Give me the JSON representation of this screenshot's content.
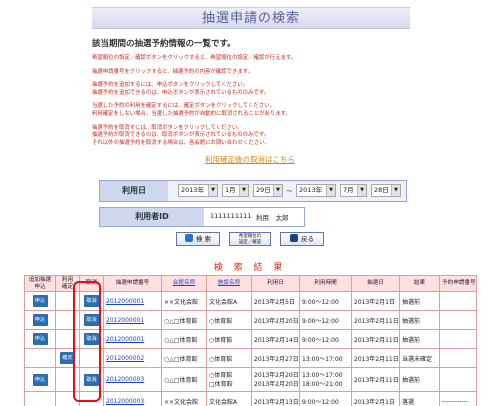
{
  "page": {
    "title": "抽選申請の検索"
  },
  "intro": {
    "heading": "該当期間の抽選予約情報の一覧です。",
    "lines": [
      "希望順位の設定／確認ボタンをクリックすると、希望順位の設定／確認が行えます。",
      "",
      "抽選申請番号をクリックすると、抽選予約の内容が確認できます。",
      "",
      "抽選予約を追加するには、申込ボタンをクリックしてください。",
      "抽選予約を追加できるのは、申込ボタンが表示されているもののみです。",
      "",
      "当選した予約の利用を確定するには、確定ボタンをクリックしてください。",
      "利用確定をしない場合、当選した抽選予約が自動的に取消されることがあります。",
      "",
      "抽選予約を取消すには、取消ボタンをクリックしてください。",
      "抽選予約が取消できるのは、取消ボタンが表示されているもののみです。",
      "それ以外の抽選予約を取消する場合は、各会館にお問い合わせください。"
    ]
  },
  "after_cancel_link": "利用確定後の取消はこちら",
  "search": {
    "date_label": "利用日",
    "from": {
      "year": "2013年",
      "month": "1月",
      "day": "29日"
    },
    "separator": "～",
    "to": {
      "year": "2013年",
      "month": "7月",
      "day": "28日"
    },
    "user_label": "利用者ID",
    "user_id": "1111111111",
    "user_name": "利用　太郎"
  },
  "buttons": {
    "search": "検 索",
    "priority_line1": "希望順位の",
    "priority_line2": "設定／確認",
    "back": "戻る"
  },
  "results": {
    "title": "検 索 結 果",
    "headers": {
      "apply_line1": "追加抽選",
      "apply_line2": "申込",
      "confirm_line1": "利用",
      "confirm_line2": "確定",
      "cancel": "取消",
      "number": "抽選申請番号",
      "hall": "会館名称",
      "facility": "施設名称",
      "use_date": "利用日",
      "use_time": "利用時間",
      "lottery_date": "抽選日",
      "result": "結果",
      "reservation_no": "予約申請番号"
    },
    "action_labels": {
      "apply": "申込",
      "confirm": "確定",
      "cancel": "取消"
    },
    "rows": [
      {
        "number": "2012000001",
        "hall": "××文化会館",
        "facility": "文化会館A",
        "date": "2013年2月5日",
        "time": "9:00～12:00",
        "lottery": "2013年2月1日",
        "result": "抽選前",
        "reservation": ""
      },
      {
        "number": "2012000001",
        "hall": "○△□体育館",
        "facility": "○体育館",
        "date": "2013年2月20日",
        "time": "9:00～12:00",
        "lottery": "2013年2月11日",
        "result": "抽選前",
        "reservation": ""
      },
      {
        "number": "2012000001",
        "hall": "○△□体育館",
        "facility": "○体育館",
        "date": "2013年2月14日",
        "time": "9:00～12:00",
        "lottery": "2013年2月11日",
        "result": "抽選前",
        "reservation": ""
      },
      {
        "number": "2012000002",
        "hall": "○△□体育館",
        "facility": "○体育館",
        "date": "2013年2月27日",
        "time": "13:00～17:00",
        "lottery": "2013年2月11日",
        "result": "当選未確定",
        "reservation": ""
      },
      {
        "number": "2012000003",
        "hall": "○△□体育館",
        "facility": "○体育館",
        "facility2": "□体育館",
        "date": "2013年2月20日",
        "date2": "2013年2月20日",
        "time": "13:00～17:00",
        "time2": "18:00～21:00",
        "lottery": "2013年2月11日",
        "result": "抽選前",
        "reservation": ""
      },
      {
        "number": "2012000003",
        "hall": "××文化会館",
        "facility": "文化会館A",
        "date": "2013年2月13日",
        "time": "9:00～12:00",
        "lottery": "2013年2月1日",
        "result": "落選",
        "reservation": "------------"
      }
    ]
  },
  "colors": {
    "title_text": "#5a5f9c",
    "notice_red": "#c8281e",
    "link_orange": "#d08a1a",
    "action_blue": "#2a6eb0",
    "table_header": "#ffe0e0",
    "highlight_red": "#e01018"
  }
}
